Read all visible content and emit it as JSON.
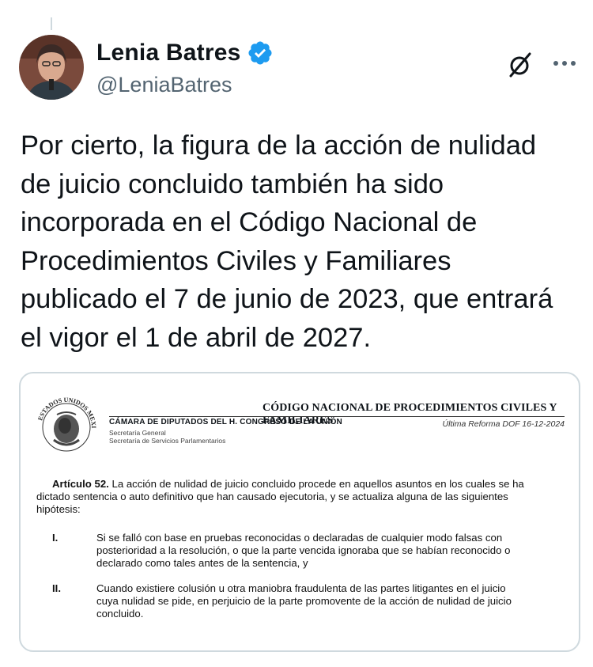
{
  "author": {
    "display_name": "Lenia Batres",
    "handle": "@LeniaBatres"
  },
  "icons": {
    "verified": "verified-badge-icon",
    "grok": "grok-icon",
    "more": "more-dots-icon"
  },
  "colors": {
    "verified_blue": "#1d9bf0",
    "text": "#0f1419",
    "secondary": "#536471",
    "border": "#cfd9de"
  },
  "tweet": {
    "lines": [
      "Por cierto, la figura de la acción de nulidad",
      "de juicio concluido también ha sido",
      "incorporada en el Código Nacional de",
      "Procedimientos Civiles y Familiares",
      "publicado el 7 de junio de 2023, que entrará",
      "el vigor el 1 de abril de 2027."
    ]
  },
  "document": {
    "title": "CÓDIGO NACIONAL DE PROCEDIMIENTOS CIVILES Y FAMILIARES",
    "chamber": "CÁMARA DE DIPUTADOS DEL H. CONGRESO DE LA UNIÓN",
    "secretariat_1": "Secretaría General",
    "secretariat_2": "Secretaría de Servicios Parlamentarios",
    "last_reform": "Última Reforma DOF 16-12-2024",
    "seal_text": "ESTADOS UNIDOS MEXICANOS",
    "article_label": "Artículo 52.",
    "article_lines": [
      "La acción de nulidad de juicio concluido procede en aquellos asuntos en los cuales se ha",
      "dictado sentencia o auto definitivo que han causado ejecutoria, y se actualiza alguna de las siguientes",
      "hipótesis:"
    ],
    "items": [
      {
        "num": "I.",
        "lines": [
          "Si se falló con base en pruebas reconocidas o declaradas de cualquier modo falsas con",
          "posterioridad a la resolución, o que la parte vencida ignoraba que se habían reconocido o",
          "declarado como tales antes de la sentencia, y"
        ]
      },
      {
        "num": "II.",
        "lines": [
          "Cuando existiere colusión u otra maniobra fraudulenta de las partes litigantes en el juicio",
          "cuya nulidad se pide, en perjuicio de la parte promovente de la acción de nulidad de juicio",
          "concluido."
        ]
      }
    ]
  }
}
